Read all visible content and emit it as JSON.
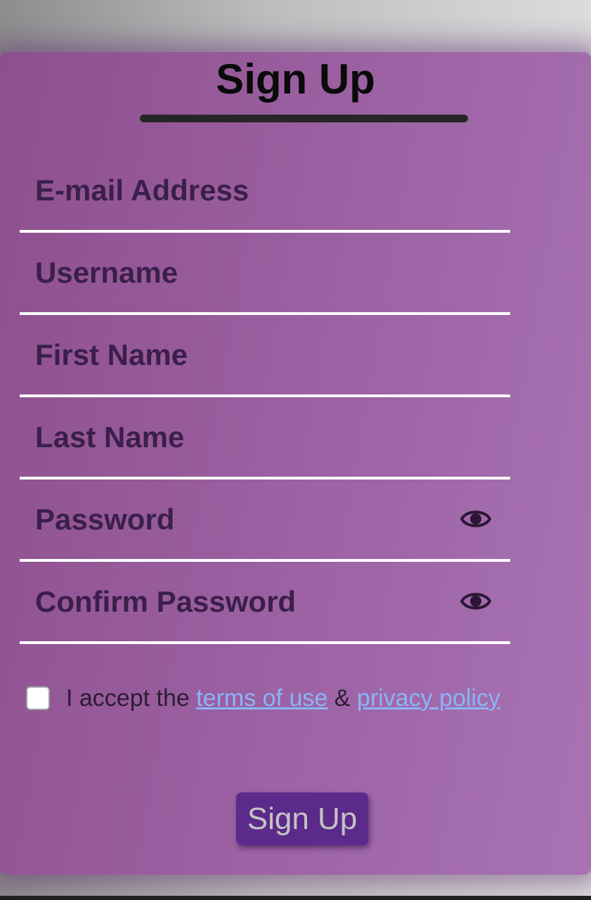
{
  "form": {
    "title": "Sign Up",
    "fields": [
      {
        "name": "email",
        "placeholder": "E-mail Address",
        "value": ""
      },
      {
        "name": "username",
        "placeholder": "Username",
        "value": ""
      },
      {
        "name": "first_name",
        "placeholder": "First Name",
        "value": ""
      },
      {
        "name": "last_name",
        "placeholder": "Last Name",
        "value": ""
      },
      {
        "name": "password",
        "placeholder": "Password",
        "value": "",
        "icon": "eye-icon"
      },
      {
        "name": "confirm_password",
        "placeholder": "Confirm Password",
        "value": "",
        "icon": "eye-icon"
      }
    ],
    "terms": {
      "checked": false,
      "prefix": "I accept the",
      "link_terms": "terms of use",
      "separator": "&",
      "link_privacy": "privacy policy"
    },
    "submit_label": "Sign Up"
  },
  "colors": {
    "card_gradient_start": "#8e4f8e",
    "card_gradient_end": "#a873b4",
    "field_text": "#3a1f4a",
    "link": "#8ab4f8",
    "button_bg": "#5b2a8a",
    "button_text": "#c4c4c4"
  }
}
